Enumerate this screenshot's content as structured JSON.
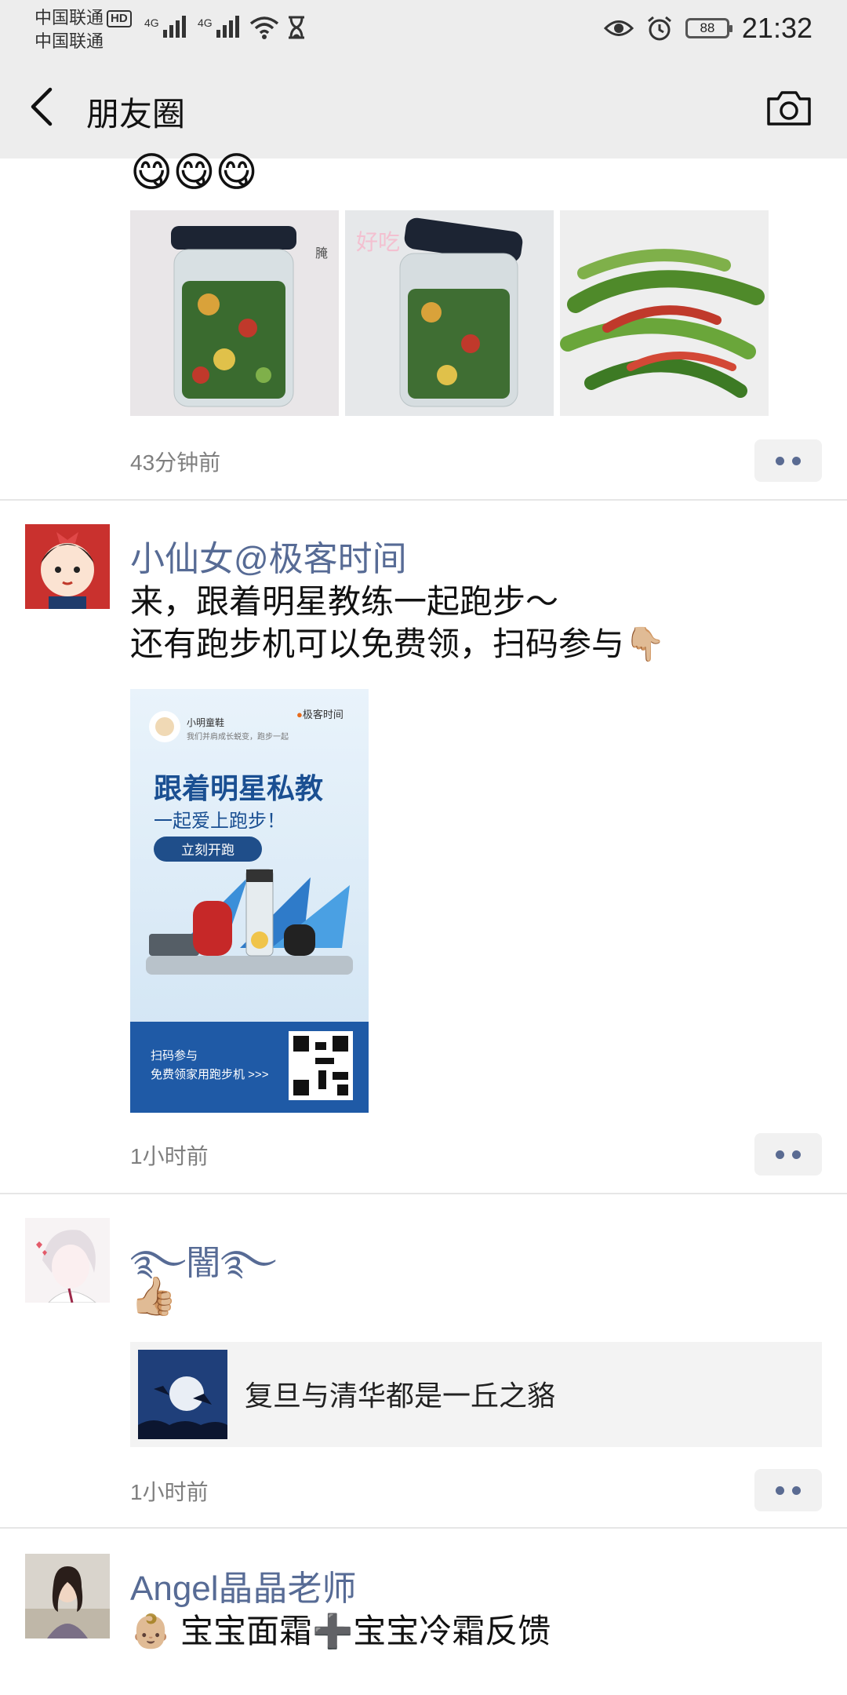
{
  "status_bar": {
    "carrier1": "中国联通",
    "carrier2": "中国联通",
    "hd": "HD",
    "net1": "4G",
    "net2": "4G",
    "battery": "88",
    "time": "21:32"
  },
  "nav": {
    "title": "朋友圈"
  },
  "posts": [
    {
      "time": "43分钟前"
    },
    {
      "name": "小仙女@极客时间",
      "line1": "来，跟着明星教练一起跑步～",
      "line2": "还有跑步机可以免费领，扫码参与👇🏼",
      "poster": {
        "brand": "小明童鞋",
        "brand_sub": "我们并肩成长蜕变，跑步一起",
        "logo_text": "极客时间",
        "headline": "跟着明星私教",
        "subline": "一起爱上跑步！",
        "button": "立刻开跑",
        "footer1": "扫码参与",
        "footer2": "免费领家用跑步机 >>>"
      },
      "time": "1小时前"
    },
    {
      "name": "࿐闇࿐",
      "text": "👍🏼",
      "link_title": "复旦与清华都是一丘之貉",
      "time": "1小时前"
    },
    {
      "name": "Angel晶晶老师",
      "text": "👶🏼 宝宝面霜➕宝宝冷霜反馈"
    }
  ],
  "colors": {
    "name_blue": "#576b95",
    "bg_gray": "#ededed",
    "timestamp_gray": "#7f7f7f"
  }
}
